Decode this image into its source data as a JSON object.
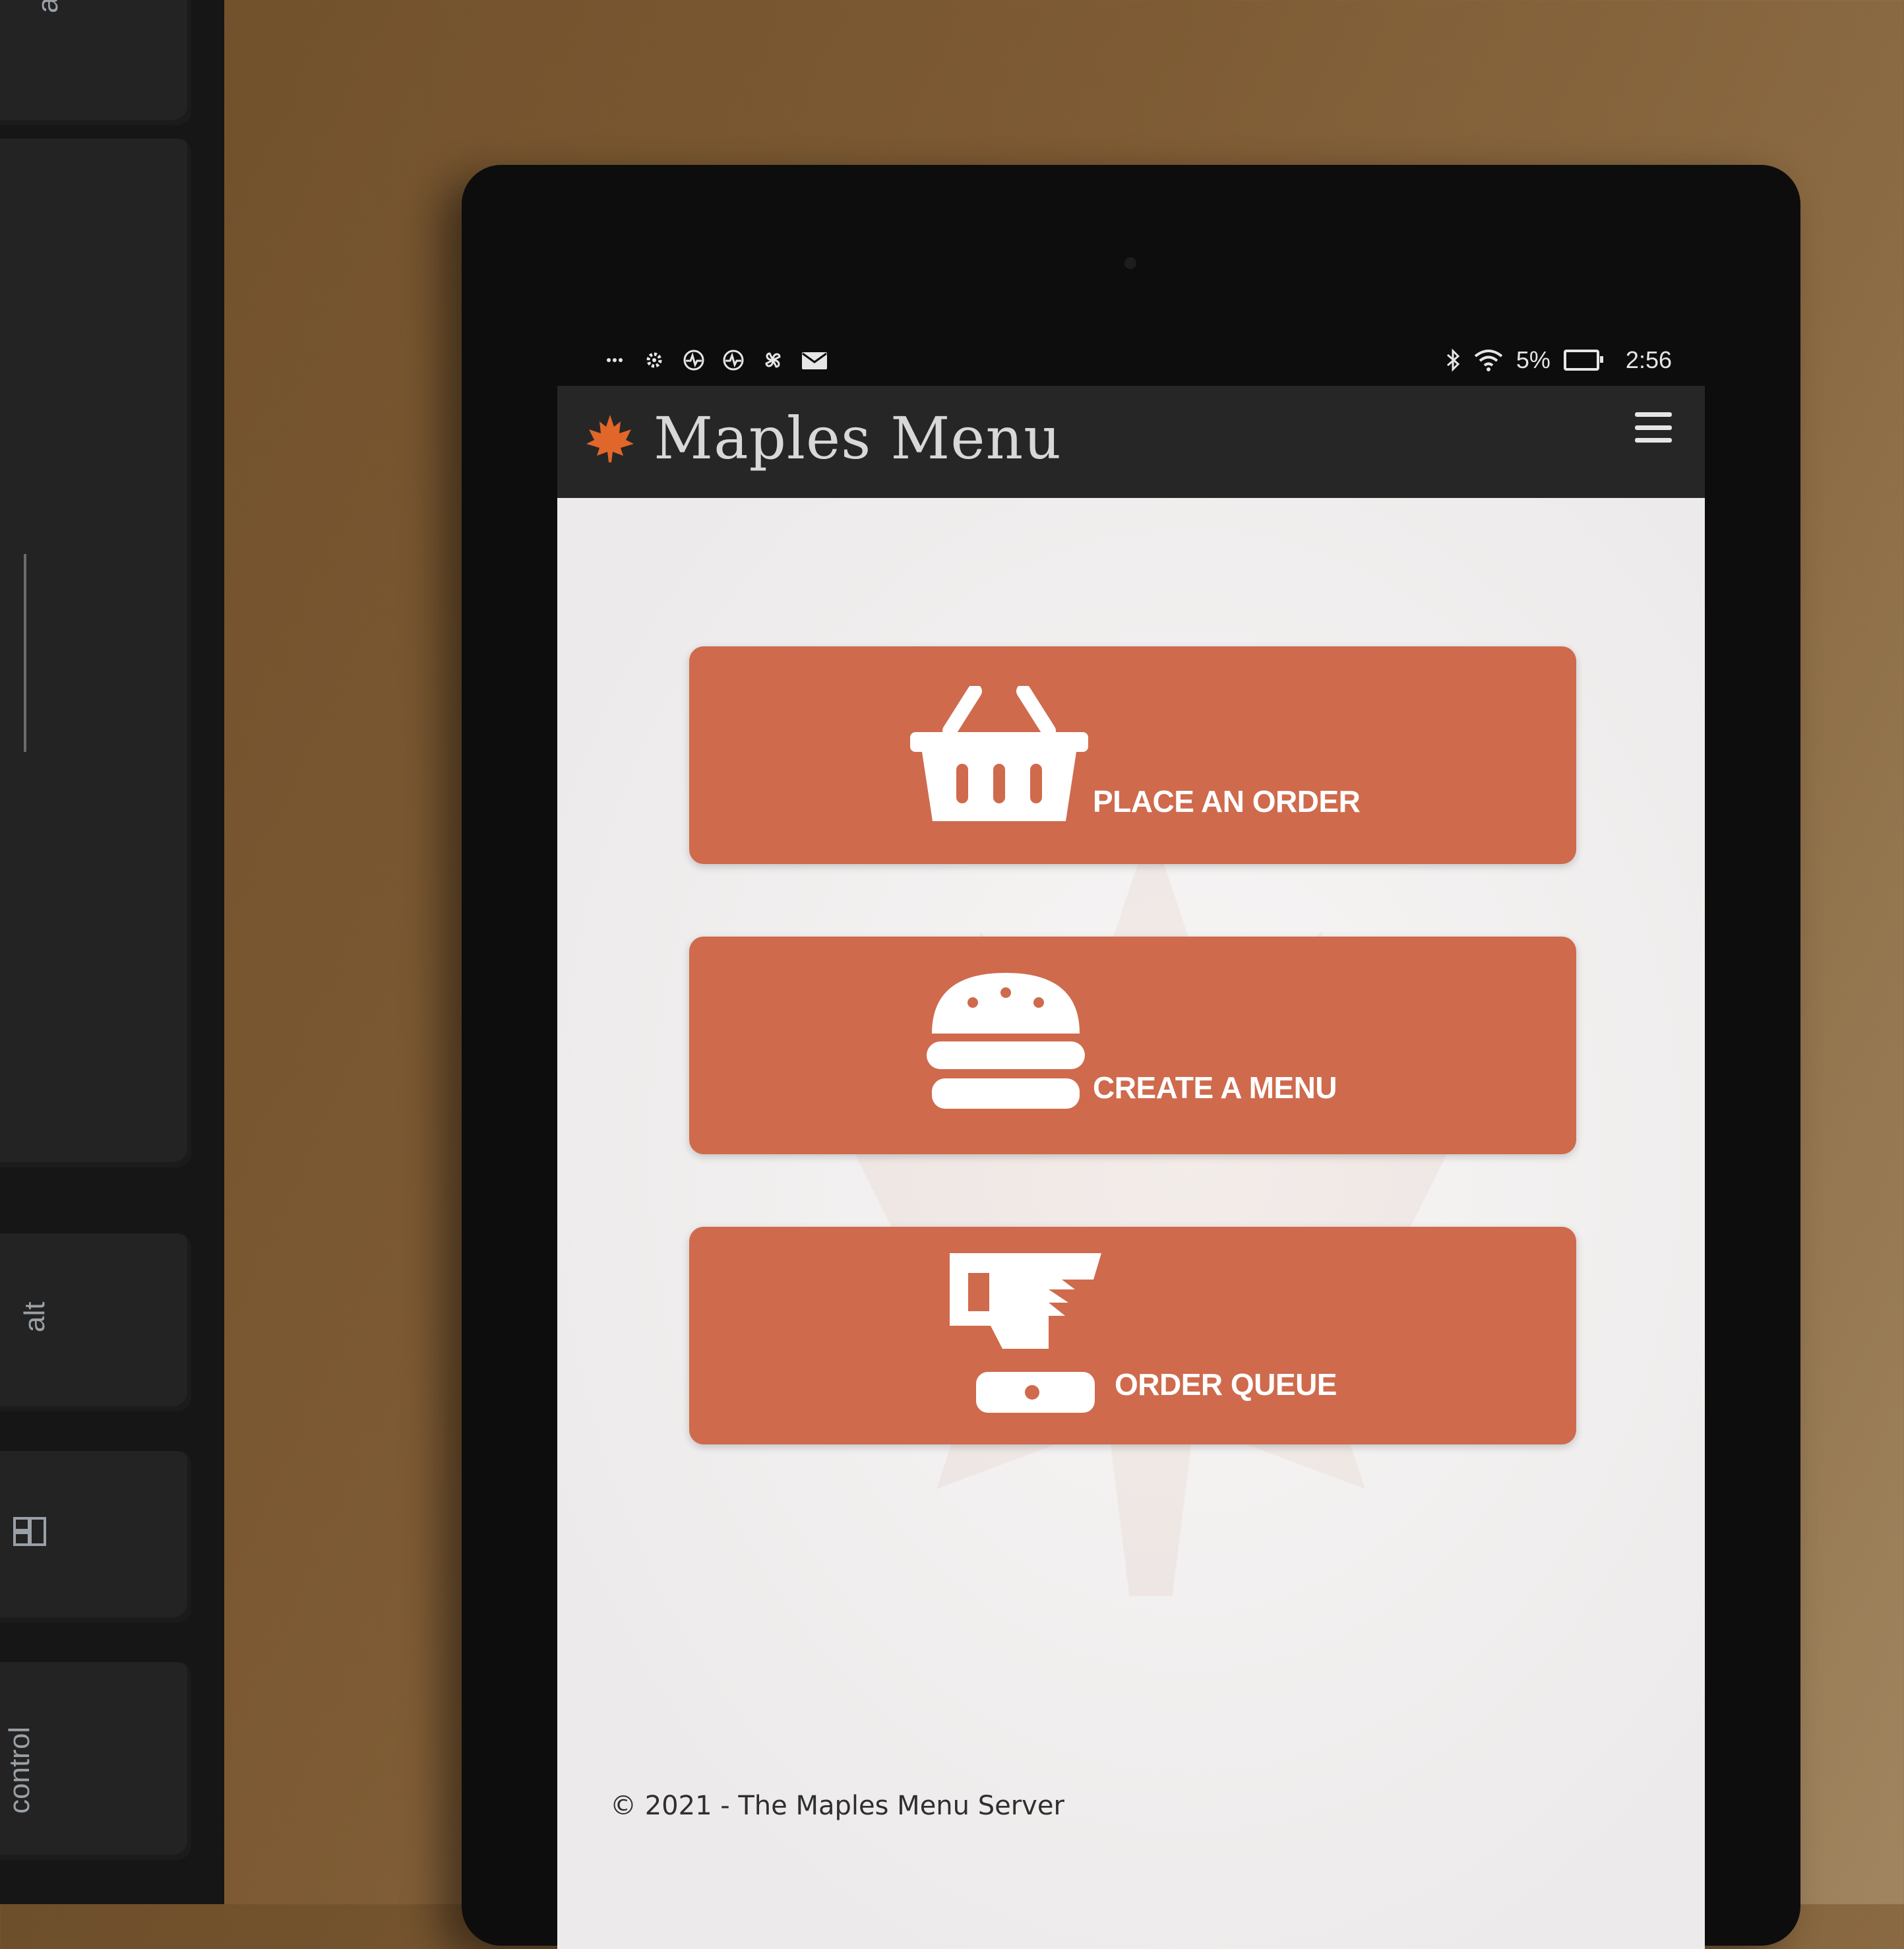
{
  "keyboard": {
    "keys": [
      "alt",
      "alt",
      "control"
    ]
  },
  "statusbar": {
    "left_icons": [
      "more-icon",
      "gear-icon",
      "activity-icon",
      "activity-icon",
      "pinwheel-icon",
      "mail-icon"
    ],
    "battery": "5%",
    "time": "2:56"
  },
  "navbar": {
    "title": "Maples Menu",
    "logo": "maple-leaf-icon",
    "menu_icon": "hamburger-icon"
  },
  "tiles": [
    {
      "label": "PLACE AN ORDER",
      "icon": "basket-icon"
    },
    {
      "label": "CREATE A MENU",
      "icon": "burger-icon"
    },
    {
      "label": "ORDER QUEUE",
      "icon": "ticket-printer-icon"
    }
  ],
  "footer": {
    "text": "© 2021 - The Maples Menu Server"
  },
  "colors": {
    "accent": "#cf6a4d",
    "navbar": "#262626",
    "logo": "#e0662a"
  }
}
